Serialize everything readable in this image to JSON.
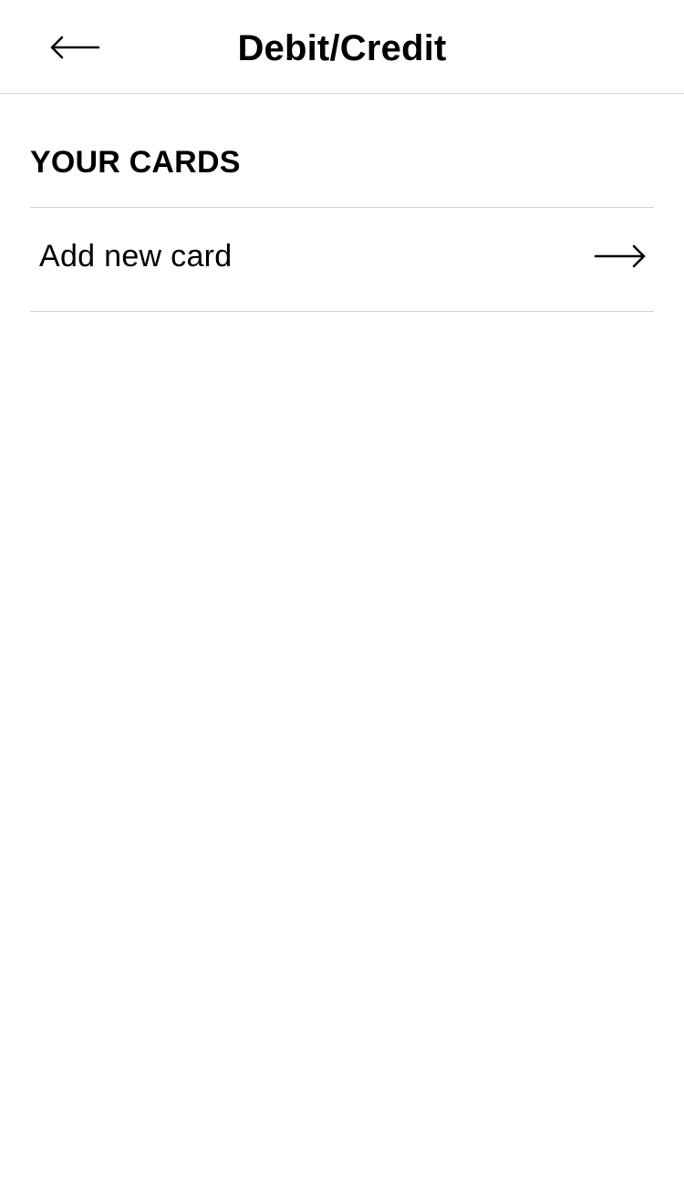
{
  "header": {
    "title": "Debit/Credit",
    "back_icon": "arrow-left-icon"
  },
  "cards_section": {
    "heading": "YOUR CARDS",
    "add_card": {
      "label": "Add new card",
      "icon": "arrow-right-icon"
    }
  },
  "colors": {
    "background": "#ffffff",
    "text": "#000000",
    "divider": "#d6d6d6"
  }
}
